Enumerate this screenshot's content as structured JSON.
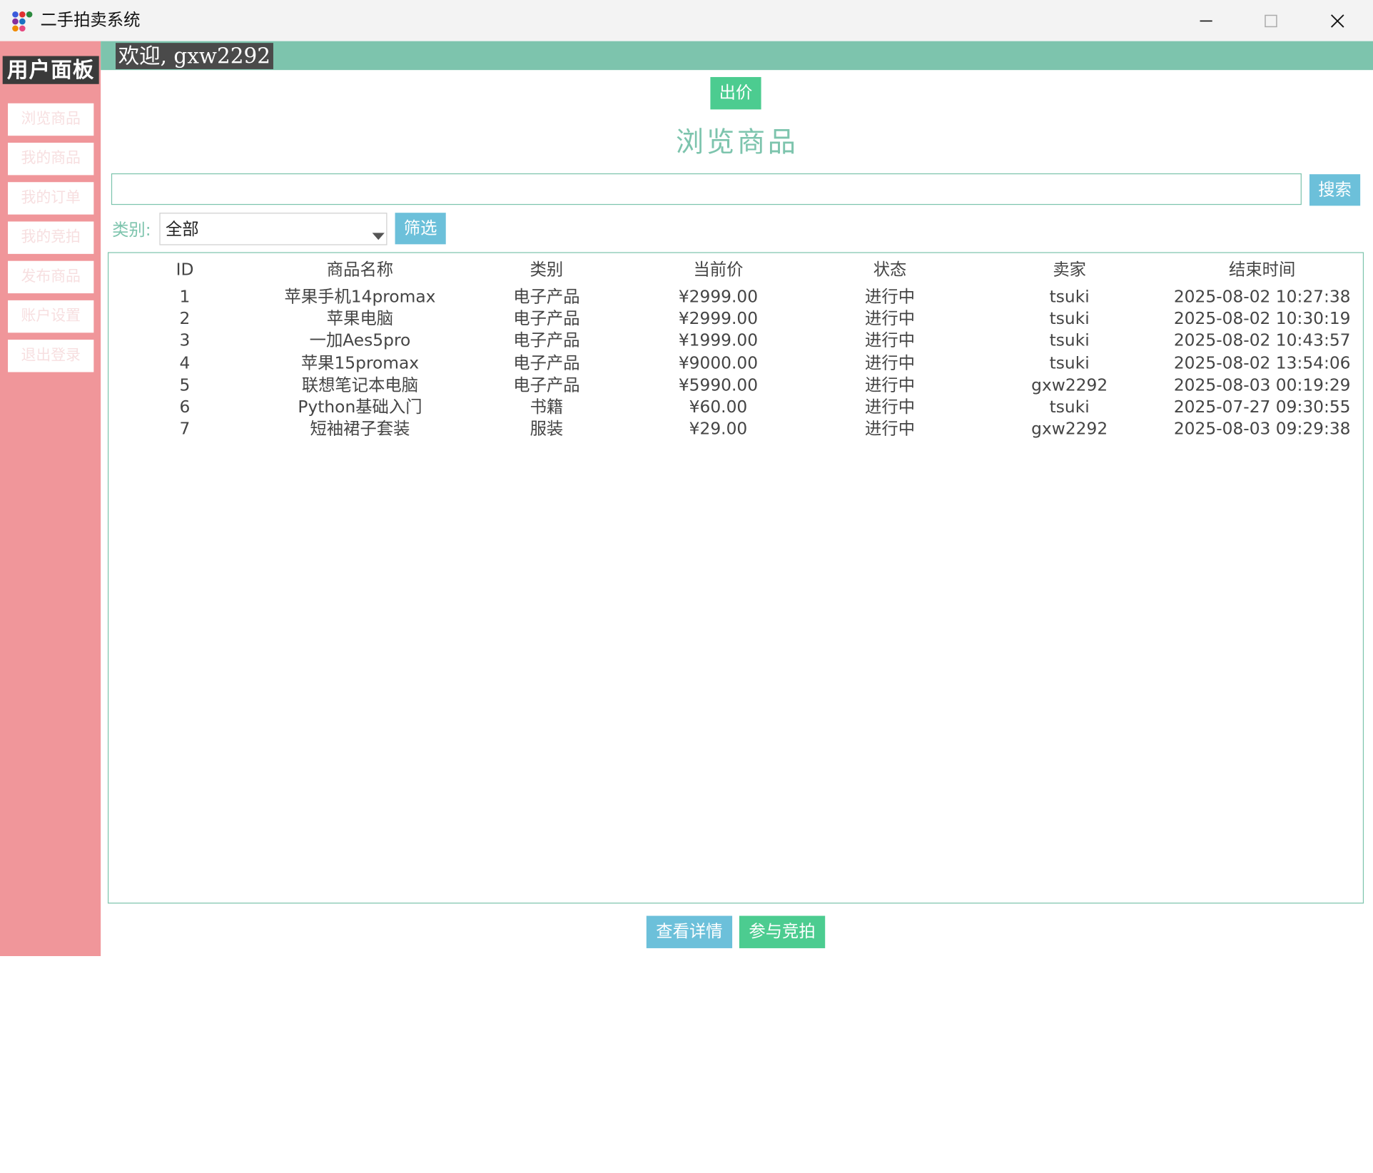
{
  "window": {
    "title": "二手拍卖系统",
    "controls": {
      "minimize": "—",
      "maximize": "☐",
      "close": "✕"
    }
  },
  "sidebar": {
    "title": "用户面板",
    "items": [
      {
        "label": "浏览商品"
      },
      {
        "label": "我的商品"
      },
      {
        "label": "我的订单"
      },
      {
        "label": "我的竞拍"
      },
      {
        "label": "发布商品"
      },
      {
        "label": "账户设置"
      },
      {
        "label": "退出登录"
      }
    ]
  },
  "header": {
    "welcome": "欢迎, gxw2292"
  },
  "main": {
    "bid_button": "出价",
    "page_title": "浏览商品",
    "search": {
      "value": "",
      "button": "搜索"
    },
    "filter": {
      "label": "类别:",
      "selected": "全部",
      "button": "筛选"
    },
    "table": {
      "columns": [
        "ID",
        "商品名称",
        "类别",
        "当前价",
        "状态",
        "卖家",
        "结束时间"
      ],
      "rows": [
        [
          "1",
          "苹果手机14promax",
          "电子产品",
          "¥2999.00",
          "进行中",
          "tsuki",
          "2025-08-02 10:27:38"
        ],
        [
          "2",
          "苹果电脑",
          "电子产品",
          "¥2999.00",
          "进行中",
          "tsuki",
          "2025-08-02 10:30:19"
        ],
        [
          "3",
          "一加Aes5pro",
          "电子产品",
          "¥1999.00",
          "进行中",
          "tsuki",
          "2025-08-02 10:43:57"
        ],
        [
          "4",
          "苹果15promax",
          "电子产品",
          "¥9000.00",
          "进行中",
          "tsuki",
          "2025-08-02 13:54:06"
        ],
        [
          "5",
          "联想笔记本电脑",
          "电子产品",
          "¥5990.00",
          "进行中",
          "gxw2292",
          "2025-08-03 00:19:29"
        ],
        [
          "6",
          "Python基础入门",
          "书籍",
          "¥60.00",
          "进行中",
          "tsuki",
          "2025-07-27 09:30:55"
        ],
        [
          "7",
          "短袖裙子套装",
          "服装",
          "¥29.00",
          "进行中",
          "gxw2292",
          "2025-08-03 09:29:38"
        ]
      ]
    },
    "footer_buttons": {
      "details": "查看详情",
      "join": "参与竞拍"
    }
  },
  "colors": {
    "sidebar_bg": "#f0969a",
    "accent_teal": "#7dc4ad",
    "button_green": "#4ccc90",
    "button_blue": "#6cc0da"
  },
  "icons": [
    "app-icon",
    "minimize-icon",
    "maximize-icon",
    "close-icon",
    "dropdown-arrow-icon"
  ]
}
